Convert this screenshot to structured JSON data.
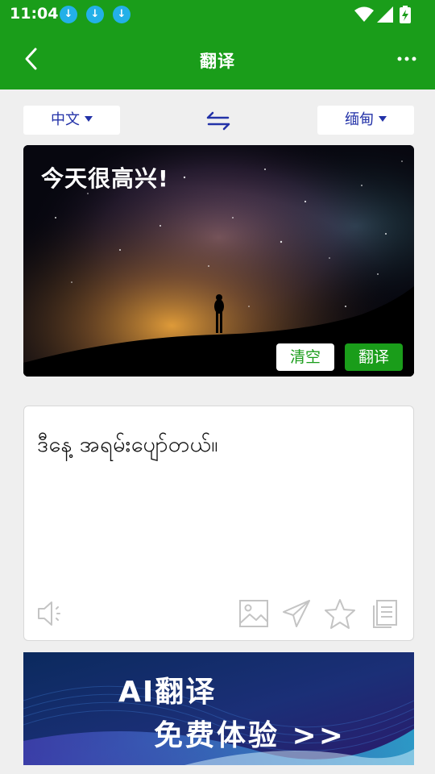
{
  "status_bar": {
    "time": "11:04",
    "notification_icons": [
      "download-icon",
      "download-icon",
      "download-icon"
    ],
    "system_icons": [
      "wifi-icon",
      "cell-signal-icon",
      "battery-charging-icon"
    ]
  },
  "app_bar": {
    "title": "翻译",
    "back_icon": "back-arrow-icon",
    "more_icon": "more-dots-icon"
  },
  "languages": {
    "source": "中文",
    "target": "缅甸",
    "swap_icon": "swap-arrows-icon"
  },
  "input": {
    "text": "今天很高兴!",
    "clear_label": "清空",
    "translate_label": "翻译"
  },
  "output": {
    "text": "ဒီနေ့ အရမ်းပျော်တယ်။",
    "actions": [
      "speaker-icon",
      "image-icon",
      "send-icon",
      "star-icon",
      "copy-icon"
    ]
  },
  "banner": {
    "line1": "AI翻译",
    "line2": "免费体验 >>"
  },
  "colors": {
    "brand_green": "#1a9d1a",
    "language_blue": "#2332a8",
    "background": "#efefef"
  }
}
